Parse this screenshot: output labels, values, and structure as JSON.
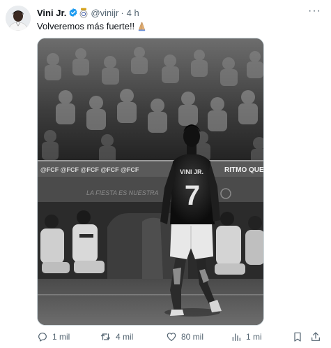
{
  "author": {
    "name": "Vini Jr.",
    "handle": "@vinijr",
    "separator": "·",
    "time": "4 h"
  },
  "tweet": {
    "text": "Volveremos más fuerte!!"
  },
  "photo": {
    "jersey_name": "VINI JR.",
    "jersey_number": "7",
    "banner_text_left": "@FCF @FCF @FCF @FCF @FCF",
    "banner_text_right": "RITMO QUE",
    "wall_text": "LA FIESTA ES NUESTRA",
    "style": "black-and-white"
  },
  "actions": {
    "replies": "1 mil",
    "reposts": "4 mil",
    "likes": "80 mil",
    "views": "1 mi"
  },
  "colors": {
    "text": "#0f1419",
    "secondary": "#536471",
    "verified": "#1d9bf0"
  }
}
